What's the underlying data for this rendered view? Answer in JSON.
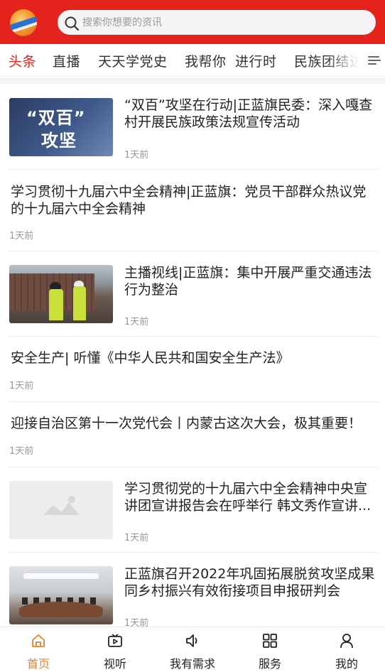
{
  "header": {
    "search_placeholder": "搜索你想要的资讯",
    "accent_color": "#e4231d"
  },
  "tabs": [
    {
      "label": "头条",
      "active": true
    },
    {
      "label": "直播",
      "active": false
    },
    {
      "label": "天天学党史",
      "active": false
    },
    {
      "label": "我帮你",
      "active": false
    },
    {
      "label": "进行时",
      "active": false
    },
    {
      "label": "民族团结进",
      "active": false
    }
  ],
  "news": [
    {
      "title": "“双百”攻坚在行动|正蓝旗民委：深入嘎查村开展民族政策法规宣传活动",
      "time": "1天前",
      "thumb_text_1": "“双百”",
      "thumb_text_2": "攻坚"
    },
    {
      "title": "学习贯彻十九届六中全会精神|正蓝旗：党员干部群众热议党的十九届六中全会精神",
      "time": "1天前"
    },
    {
      "title": "主播视线|正蓝旗：集中开展严重交通违法行为整治",
      "time": "1天前"
    },
    {
      "title": "安全生产|  听懂《中华人民共和国安全生产法》",
      "time": "1天前"
    },
    {
      "title": "迎接自治区第十一次党代会丨内蒙古这次大会，极其重要！",
      "time": "1天前"
    },
    {
      "title": "学习贯彻党的十九届六中全会精神中央宣讲团宣讲报告会在呼举行  韩文秀作宣讲...",
      "time": "1天前"
    },
    {
      "title": "正蓝旗召开2022年巩固拓展脱贫攻坚成果同乡村振兴有效衔接项目申报研判会",
      "time": "1天前"
    }
  ],
  "bottom_nav": [
    {
      "label": "首页",
      "icon": "home-icon",
      "active": true
    },
    {
      "label": "视听",
      "icon": "video-icon",
      "active": false
    },
    {
      "label": "我有需求",
      "icon": "speaker-icon",
      "active": false
    },
    {
      "label": "服务",
      "icon": "grid-icon",
      "active": false
    },
    {
      "label": "我的",
      "icon": "user-icon",
      "active": false
    }
  ],
  "colors": {
    "active_nav": "#e8832a",
    "time_text": "#999999"
  }
}
